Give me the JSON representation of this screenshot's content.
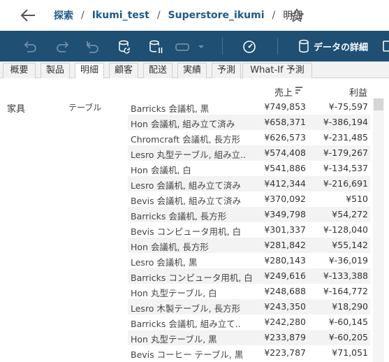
{
  "breadcrumb": {
    "items": [
      "探索",
      "Ikumi_test",
      "Superstore_ikumi"
    ],
    "current": "明細",
    "separator": "/"
  },
  "toolbar": {
    "detail_label": "データの詳細",
    "icons": [
      "undo-icon",
      "redo-icon",
      "revert-icon",
      "refresh-icon",
      "pause-updates-icon",
      "swap-icon",
      "dropdown-icon",
      "metrics-icon",
      "data-source-icon"
    ]
  },
  "tabs": [
    "概要",
    "製品",
    "明細",
    "顧客",
    "配送",
    "実績",
    "予測",
    "What-If 予測"
  ],
  "active_tab": "明細",
  "columns": {
    "sales": "売上",
    "profit": "利益"
  },
  "category": "家具",
  "subcategory": "テーブル",
  "rows": [
    {
      "product": "Barricks 会議机, 黒",
      "sales": "¥749,853",
      "profit": "¥-75,597"
    },
    {
      "product": "Hon 会議机, 組み立て済み",
      "sales": "¥658,371",
      "profit": "¥-386,194"
    },
    {
      "product": "Chromcraft 会議机, 長方形",
      "sales": "¥626,573",
      "profit": "¥-231,485"
    },
    {
      "product": "Lesro 丸型テーブル, 組み立..",
      "sales": "¥574,408",
      "profit": "¥-179,267"
    },
    {
      "product": "Hon 会議机, 白",
      "sales": "¥541,886",
      "profit": "¥-134,537"
    },
    {
      "product": "Lesro 会議机, 組み立て済み",
      "sales": "¥412,344",
      "profit": "¥-216,691"
    },
    {
      "product": "Bevis 会議机, 組み立て済み",
      "sales": "¥370,092",
      "profit": "¥510"
    },
    {
      "product": "Barricks 会議机, 長方形",
      "sales": "¥349,798",
      "profit": "¥54,272"
    },
    {
      "product": "Bevis コンピュータ用机, 白",
      "sales": "¥301,337",
      "profit": "¥-128,040"
    },
    {
      "product": "Hon 会議机, 長方形",
      "sales": "¥281,842",
      "profit": "¥55,142"
    },
    {
      "product": "Lesro 会議机, 黒",
      "sales": "¥280,143",
      "profit": "¥-36,019"
    },
    {
      "product": "Barricks コンピュータ用机, 白",
      "sales": "¥249,616",
      "profit": "¥-133,388"
    },
    {
      "product": "Hon 丸型テーブル, 白",
      "sales": "¥248,688",
      "profit": "¥-164,772"
    },
    {
      "product": "Lesro 木製テーブル, 長方形",
      "sales": "¥243,350",
      "profit": "¥18,290"
    },
    {
      "product": "Barricks 会議机, 組み立て..",
      "sales": "¥242,280",
      "profit": "¥-60,145"
    },
    {
      "product": "Hon 丸型テーブル, 黒",
      "sales": "¥233,879",
      "profit": "¥-60,205"
    },
    {
      "product": "Bevis コーヒー テーブル, 黒",
      "sales": "¥223,787",
      "profit": "¥71,051"
    }
  ],
  "colors": {
    "toolbar_bg": "#1f4f73",
    "link": "#1f5a8a",
    "band": "#f3f3f3"
  }
}
